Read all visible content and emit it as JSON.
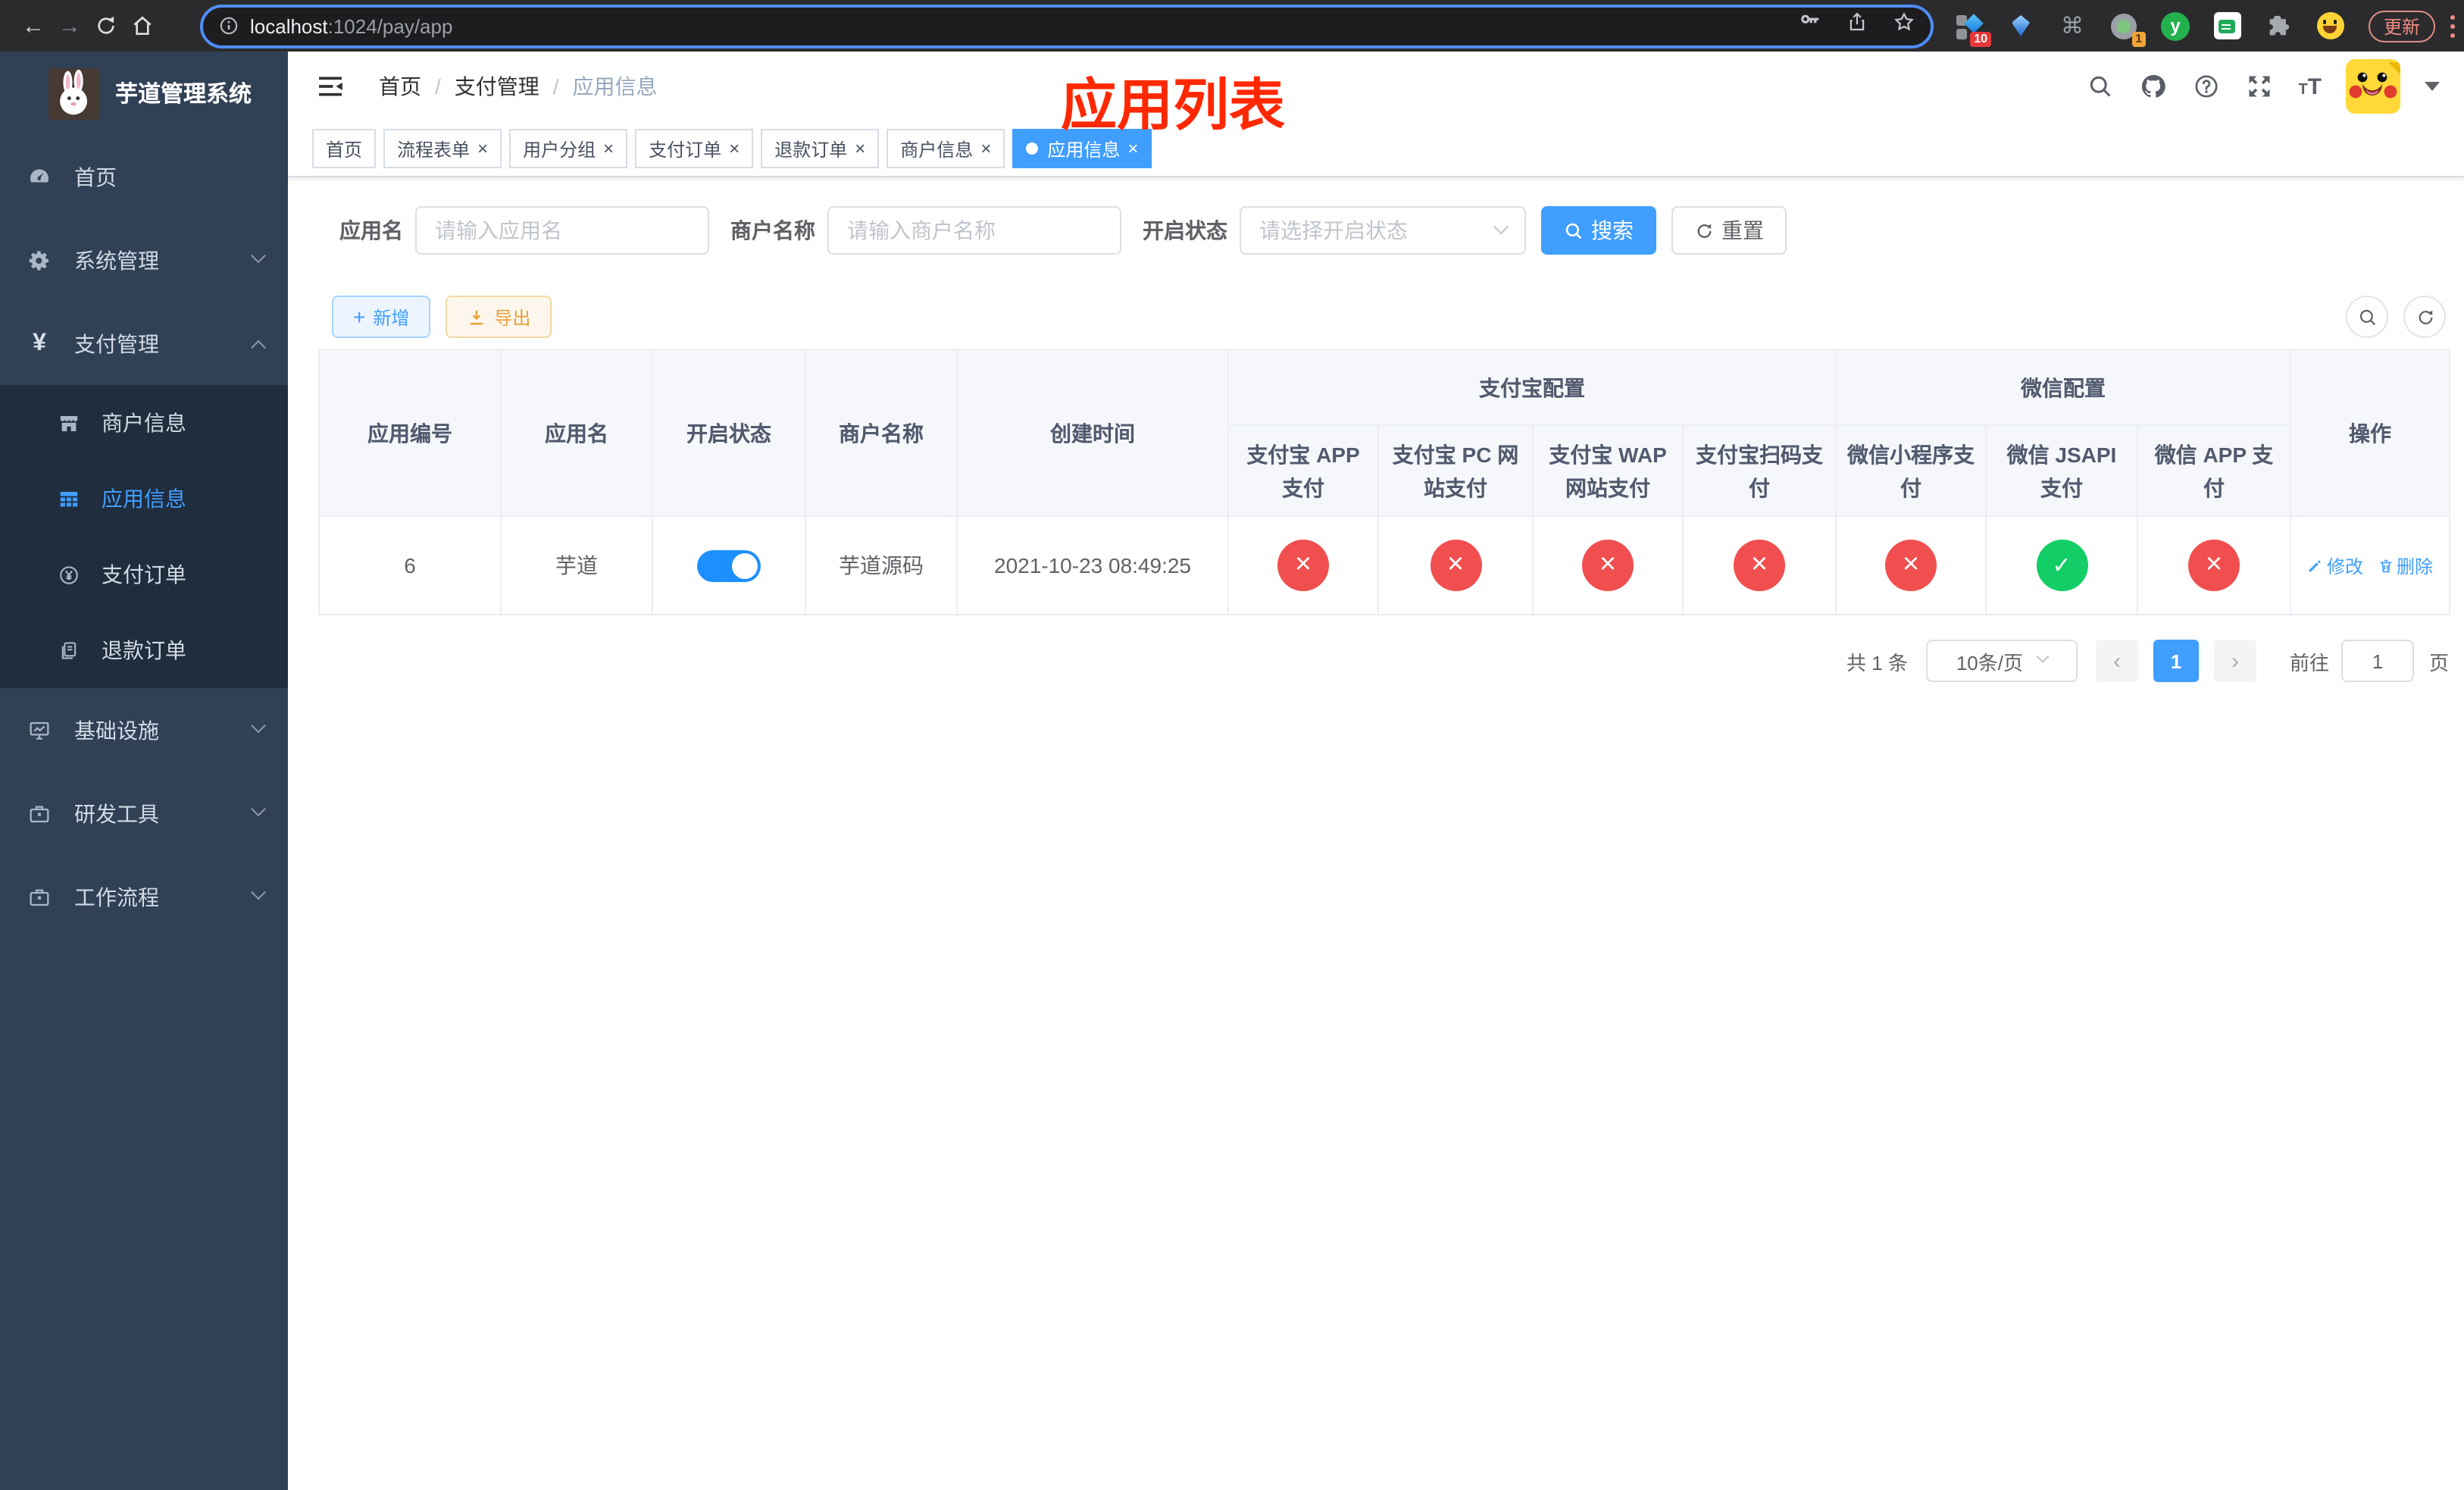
{
  "browser": {
    "url": {
      "host": "localhost",
      "path": ":1024/pay/app"
    },
    "update_label": "更新",
    "extensions": {
      "badge_a": "10",
      "badge_b": "1",
      "y_letter": "y"
    }
  },
  "sidebar": {
    "title": "芋道管理系统",
    "menu": [
      {
        "label": "首页"
      },
      {
        "label": "系统管理"
      },
      {
        "label": "支付管理"
      },
      {
        "label": "基础设施"
      },
      {
        "label": "研发工具"
      },
      {
        "label": "工作流程"
      }
    ],
    "submenu": [
      {
        "label": "商户信息"
      },
      {
        "label": "应用信息"
      },
      {
        "label": "支付订单"
      },
      {
        "label": "退款订单"
      }
    ]
  },
  "header": {
    "breadcrumb": [
      "首页",
      "支付管理",
      "应用信息"
    ],
    "font_icon": "T"
  },
  "overlay_title": "应用列表",
  "tabs": [
    {
      "label": "首页"
    },
    {
      "label": "流程表单"
    },
    {
      "label": "用户分组"
    },
    {
      "label": "支付订单"
    },
    {
      "label": "退款订单"
    },
    {
      "label": "商户信息"
    },
    {
      "label": "应用信息"
    }
  ],
  "filters": {
    "app_name_label": "应用名",
    "app_name_placeholder": "请输入应用名",
    "merchant_label": "商户名称",
    "merchant_placeholder": "请输入商户名称",
    "status_label": "开启状态",
    "status_placeholder": "请选择开启状态",
    "search_label": "搜索",
    "reset_label": "重置"
  },
  "toolbar": {
    "add_label": "新增",
    "export_label": "导出"
  },
  "table": {
    "merged_columns": [
      "应用编号",
      "应用名",
      "开启状态",
      "商户名称",
      "创建时间"
    ],
    "alipay_group": "支付宝配置",
    "alipay_columns": [
      "支付宝 APP 支付",
      "支付宝 PC 网站支付",
      "支付宝 WAP 网站支付",
      "支付宝扫码支付"
    ],
    "wechat_group": "微信配置",
    "wechat_columns": [
      "微信小程序支付",
      "微信 JSAPI 支付",
      "微信 APP 支付"
    ],
    "actions_column": "操作",
    "row": {
      "id": "6",
      "name": "芋道",
      "status": "on",
      "merchant": "芋道源码",
      "created_at": "2021-10-23 08:49:25",
      "configs": [
        "no",
        "no",
        "no",
        "no",
        "no",
        "yes",
        "no"
      ],
      "edit_label": "修改",
      "delete_label": "删除"
    }
  },
  "pagination": {
    "total": "共 1 条",
    "page_size": "10条/页",
    "current_page": "1",
    "goto_label": "前往",
    "goto_value": "1",
    "page_unit": "页"
  },
  "colors": {
    "primary": "#409EFF",
    "danger": "#f14f4f",
    "success": "#13ce66",
    "warning": "#e6a23c",
    "overlay_red": "#ff2800",
    "sidebar_bg": "#304156",
    "submenu_bg": "#1f2d3d"
  }
}
